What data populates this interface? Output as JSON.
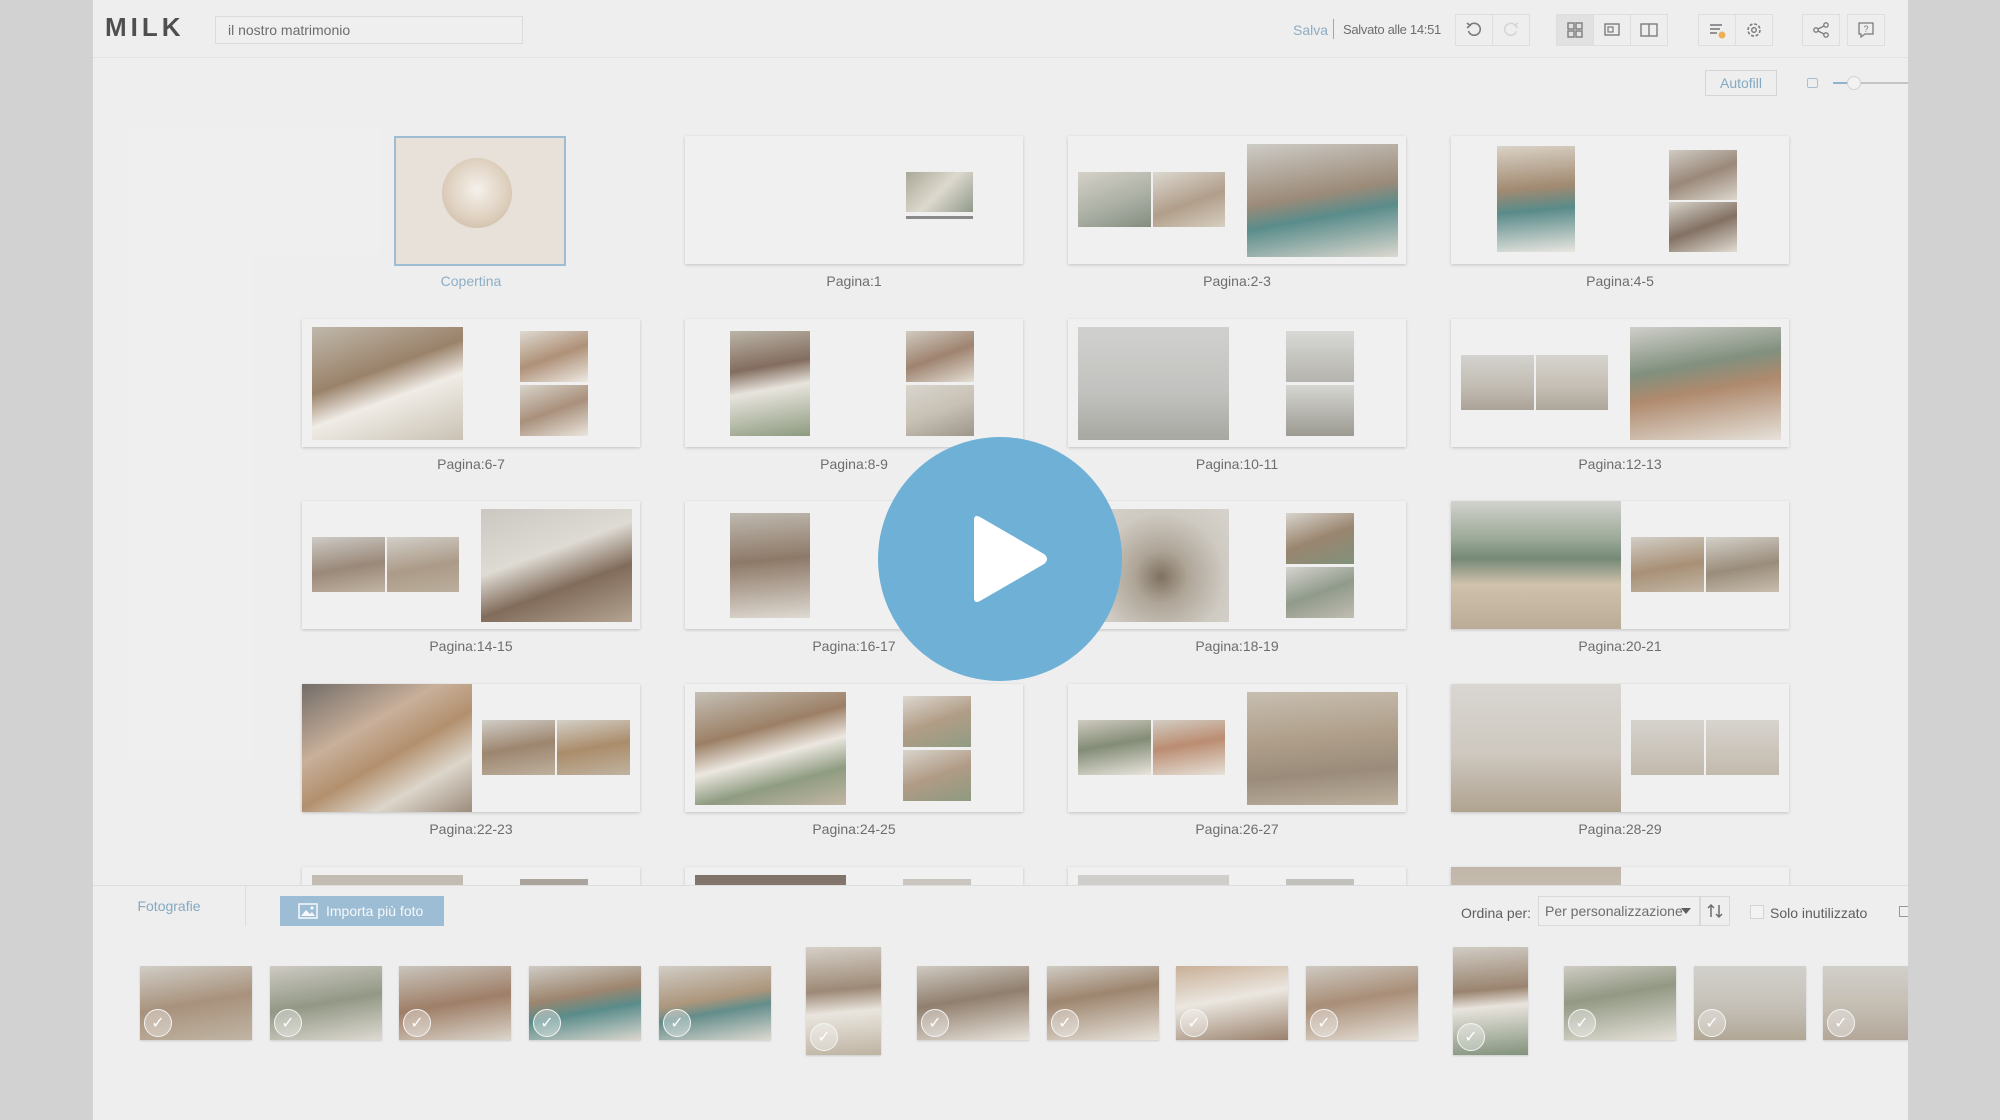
{
  "app": {
    "logo": "MILK"
  },
  "topbar": {
    "project_name": "il nostro matrimonio",
    "save_label": "Salva",
    "saved_status": "Salvato alle 14:51"
  },
  "toolbar2": {
    "autofill_label": "Autofill"
  },
  "pages": [
    {
      "label": "Copertina",
      "kind": "cover"
    },
    {
      "label": "Pagina:1"
    },
    {
      "label": "Pagina:2-3"
    },
    {
      "label": "Pagina:4-5"
    },
    {
      "label": "Pagina:6-7"
    },
    {
      "label": "Pagina:8-9"
    },
    {
      "label": "Pagina:10-11"
    },
    {
      "label": "Pagina:12-13"
    },
    {
      "label": "Pagina:14-15"
    },
    {
      "label": "Pagina:16-17"
    },
    {
      "label": "Pagina:18-19"
    },
    {
      "label": "Pagina:20-21"
    },
    {
      "label": "Pagina:22-23"
    },
    {
      "label": "Pagina:24-25"
    },
    {
      "label": "Pagina:26-27"
    },
    {
      "label": "Pagina:28-29"
    }
  ],
  "bottom": {
    "tab_label": "Fotografie",
    "import_label": "Importa più foto",
    "sort_label": "Ordina per:",
    "sort_value": "Per personalizzazione",
    "unused_label": "Solo inutilizzato"
  },
  "colors": {
    "accent": "#6f9ab8",
    "play": "#6fb0d6",
    "cover_border": "#8fb2cb"
  },
  "icons": [
    "undo-icon",
    "redo-icon",
    "grid-view-icon",
    "page-view-icon",
    "spread-view-icon",
    "list-warning-icon",
    "settings-icon",
    "share-icon",
    "help-icon",
    "image-icon",
    "sort-toggle-icon",
    "play-icon",
    "check-icon"
  ]
}
